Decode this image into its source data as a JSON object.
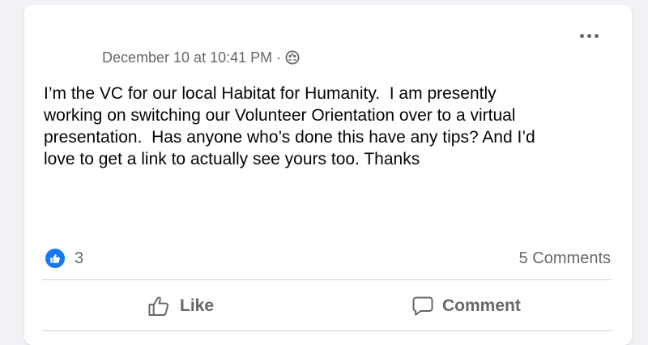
{
  "post": {
    "timestamp": "December 10 at 10:41 PM",
    "separator": "·",
    "privacy_icon": "group-privacy-icon",
    "more_icon": "more-options-icon",
    "text": "I’m the VC for our local Habitat for Humanity.  I am presently\nworking on switching our Volunteer Orientation over to a virtual\npresentation.  Has anyone who’s done this have any tips? And I’d\nlove to get a link to actually see yours too. Thanks"
  },
  "stats": {
    "reaction_icon": "like-reaction-icon",
    "reaction_count": "3",
    "comments": "5 Comments"
  },
  "actions": {
    "like_label": "Like",
    "like_icon": "thumbs-up-icon",
    "comment_label": "Comment",
    "comment_icon": "comment-bubble-icon"
  },
  "colors": {
    "background": "#f0f2f5",
    "card": "#ffffff",
    "text_primary": "#050505",
    "text_secondary": "#65676b",
    "like_blue": "#1877f2",
    "divider": "#ced0d4"
  }
}
